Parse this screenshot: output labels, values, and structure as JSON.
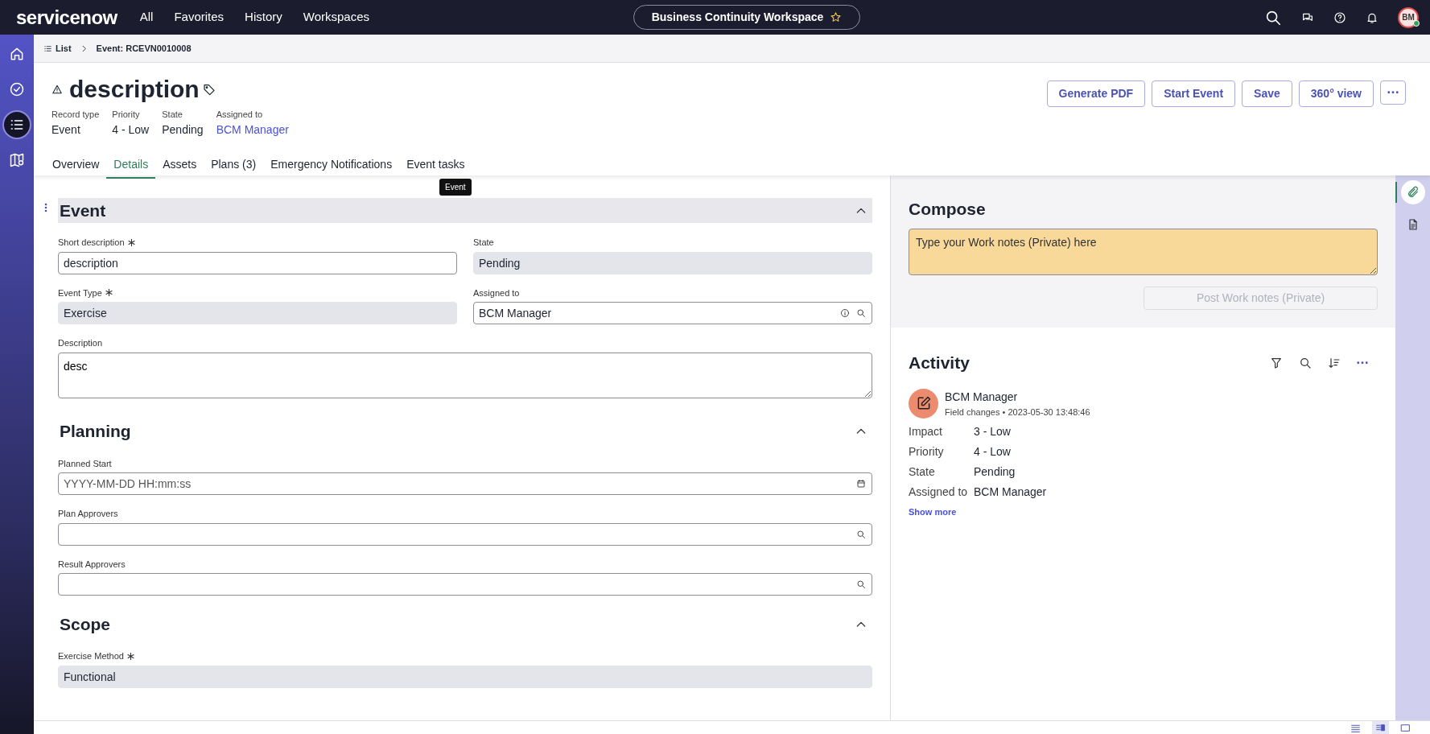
{
  "topbar": {
    "logo": "servicenow",
    "menu": [
      "All",
      "Favorites",
      "History",
      "Workspaces"
    ],
    "workspace": "Business Continuity Workspace",
    "avatar": "BM"
  },
  "rail": [
    {
      "selected": false
    },
    {
      "selected": false
    },
    {
      "selected": true
    },
    {
      "selected": false
    }
  ],
  "breadcrumb": {
    "list": "List",
    "current": "Event: RCEVN0010008"
  },
  "record": {
    "title": "description",
    "meta": [
      {
        "label": "Record type",
        "value": "Event",
        "kind": "text"
      },
      {
        "label": "Priority",
        "value": "4 - Low",
        "kind": "text"
      },
      {
        "label": "State",
        "value": "Pending",
        "kind": "text"
      },
      {
        "label": "Assigned to",
        "value": "BCM Manager",
        "kind": "link"
      }
    ]
  },
  "actions": [
    {
      "kind": "text",
      "label": "Generate PDF"
    },
    {
      "kind": "text",
      "label": "Start Event"
    },
    {
      "kind": "text",
      "label": "Save"
    },
    {
      "kind": "text",
      "label": "360° view"
    },
    {
      "kind": "more"
    }
  ],
  "tabs": [
    {
      "label": "Overview",
      "selected": false
    },
    {
      "label": "Details",
      "selected": true
    },
    {
      "label": "Assets",
      "selected": false
    },
    {
      "label": "Plans (3)",
      "selected": false
    },
    {
      "label": "Emergency Notifications",
      "selected": false
    },
    {
      "label": "Event tasks",
      "selected": false
    }
  ],
  "tooltip": "Event",
  "sections": [
    {
      "title": "Event",
      "expanded": true,
      "highlighted": true,
      "rows": [
        [
          {
            "label": "Short description",
            "required": true,
            "kind": "text",
            "value": "description",
            "readonly": false
          },
          {
            "label": "State",
            "required": false,
            "kind": "text",
            "value": "Pending",
            "readonly": true
          }
        ],
        [
          {
            "label": "Event Type",
            "required": true,
            "kind": "text",
            "value": "Exercise",
            "readonly": true
          },
          {
            "label": "Assigned to",
            "required": false,
            "kind": "lookup",
            "value": "BCM Manager",
            "readonly": false,
            "info": true
          }
        ],
        [
          {
            "label": "Description",
            "required": false,
            "kind": "textarea",
            "value": "desc",
            "readonly": false
          }
        ]
      ]
    },
    {
      "title": "Planning",
      "expanded": true,
      "highlighted": false,
      "rows": [
        [
          {
            "label": "Planned Start",
            "required": false,
            "kind": "date",
            "placeholder": "YYYY-MM-DD HH:mm:ss",
            "readonly": false
          }
        ],
        [
          {
            "label": "Plan Approvers",
            "required": false,
            "kind": "lookup",
            "readonly": false,
            "info": false
          }
        ],
        [
          {
            "label": "Result Approvers",
            "required": false,
            "kind": "lookup",
            "readonly": false,
            "info": false
          }
        ]
      ]
    },
    {
      "title": "Scope",
      "expanded": true,
      "highlighted": false,
      "rows": [
        [
          {
            "label": "Exercise Method",
            "required": true,
            "kind": "text",
            "value": "Functional",
            "readonly": true
          }
        ]
      ]
    }
  ],
  "compose": {
    "title": "Compose",
    "placeholder": "Type your Work notes (Private) here",
    "post_button": "Post Work notes (Private)",
    "post_disabled": true
  },
  "activity": {
    "title": "Activity",
    "entries": [
      {
        "author": "BCM Manager",
        "subtitle": "Field changes • 2023-05-30 13:48:46",
        "changes": [
          {
            "label": "Impact",
            "value": "3 - Low"
          },
          {
            "label": "Priority",
            "value": "4 - Low"
          },
          {
            "label": "State",
            "value": "Pending"
          },
          {
            "label": "Assigned to",
            "value": "BCM Manager"
          }
        ]
      }
    ],
    "show_more": "Show more"
  },
  "utility_rail": [
    {
      "selected": true
    },
    {
      "selected": false
    }
  ],
  "view_modes": [
    {
      "selected": false
    },
    {
      "selected": true
    },
    {
      "selected": false
    }
  ]
}
